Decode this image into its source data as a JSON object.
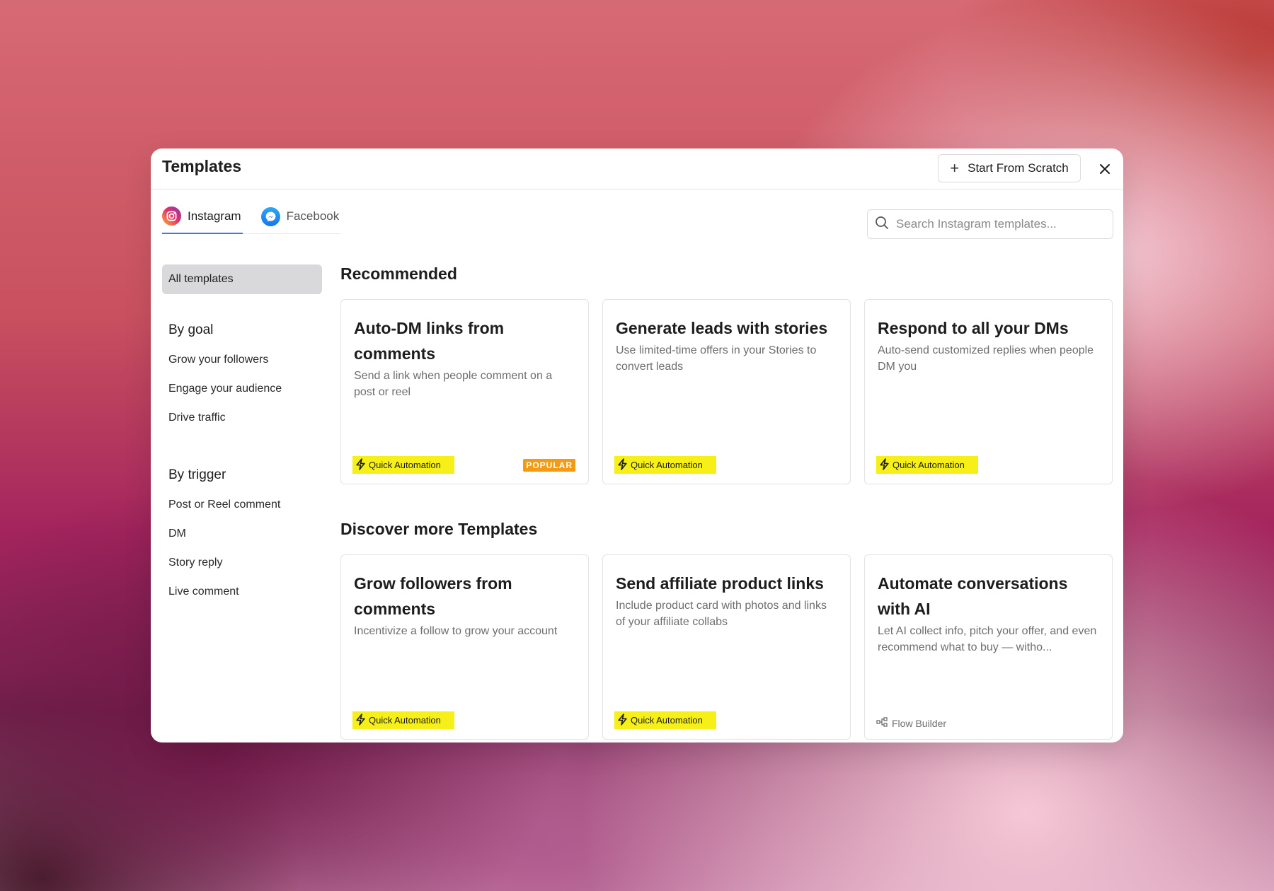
{
  "modal": {
    "title": "Templates",
    "start_button": "Start From Scratch"
  },
  "tabs": [
    {
      "label": "Instagram",
      "icon": "instagram-icon",
      "active": true
    },
    {
      "label": "Facebook",
      "icon": "messenger-icon",
      "active": false
    }
  ],
  "search": {
    "placeholder": "Search Instagram templates..."
  },
  "sidebar": {
    "all": "All templates",
    "goal": {
      "heading": "By goal",
      "items": [
        "Grow your followers",
        "Engage your audience",
        "Drive traffic"
      ]
    },
    "trigger": {
      "heading": "By trigger",
      "items": [
        "Post or Reel comment",
        "DM",
        "Story reply",
        "Live comment"
      ]
    }
  },
  "recommended": {
    "title": "Recommended",
    "cards": [
      {
        "title": "Auto-DM links from comments",
        "desc": "Send a link when people comment on a post or reel",
        "badge": "Quick Automation",
        "tag": "POPULAR"
      },
      {
        "title": "Generate leads with stories",
        "desc": "Use limited-time offers in your Stories to convert leads",
        "badge": "Quick Automation"
      },
      {
        "title": "Respond to all your DMs",
        "desc": "Auto-send customized replies when people DM you",
        "badge": "Quick Automation"
      }
    ]
  },
  "discover": {
    "title": "Discover more Templates",
    "cards": [
      {
        "title": "Grow followers from comments",
        "desc": "Incentivize a follow to grow your account",
        "badge": "Quick Automation"
      },
      {
        "title": "Send affiliate product links",
        "desc": "Include product card with photos and links of your affiliate collabs",
        "badge": "Quick Automation"
      },
      {
        "title": "Automate conversations with AI",
        "desc": "Let AI collect info, pitch your offer, and even recommend what to buy — witho...",
        "badge": "Flow Builder"
      }
    ]
  },
  "colors": {
    "accent": "#3b7be0",
    "quick_badge": "#f7f018",
    "popular_badge": "#f59b12"
  }
}
